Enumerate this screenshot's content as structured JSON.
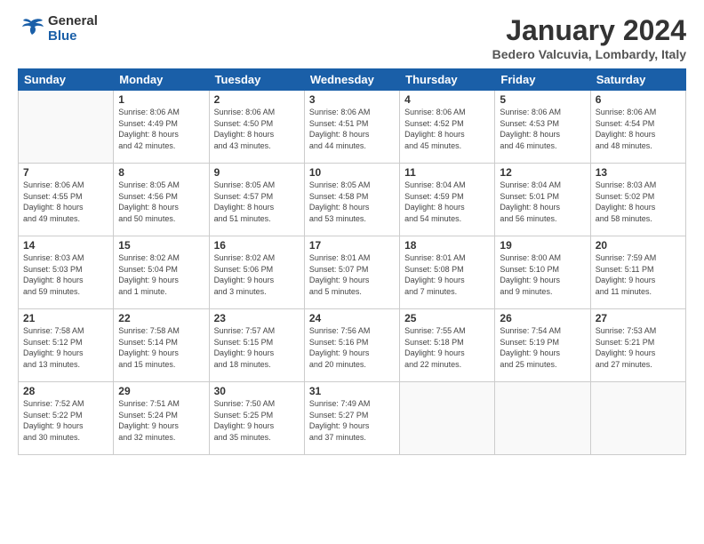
{
  "header": {
    "logo_line1": "General",
    "logo_line2": "Blue",
    "month_title": "January 2024",
    "subtitle": "Bedero Valcuvia, Lombardy, Italy"
  },
  "weekdays": [
    "Sunday",
    "Monday",
    "Tuesday",
    "Wednesday",
    "Thursday",
    "Friday",
    "Saturday"
  ],
  "weeks": [
    [
      {
        "day": "",
        "info": ""
      },
      {
        "day": "1",
        "info": "Sunrise: 8:06 AM\nSunset: 4:49 PM\nDaylight: 8 hours\nand 42 minutes."
      },
      {
        "day": "2",
        "info": "Sunrise: 8:06 AM\nSunset: 4:50 PM\nDaylight: 8 hours\nand 43 minutes."
      },
      {
        "day": "3",
        "info": "Sunrise: 8:06 AM\nSunset: 4:51 PM\nDaylight: 8 hours\nand 44 minutes."
      },
      {
        "day": "4",
        "info": "Sunrise: 8:06 AM\nSunset: 4:52 PM\nDaylight: 8 hours\nand 45 minutes."
      },
      {
        "day": "5",
        "info": "Sunrise: 8:06 AM\nSunset: 4:53 PM\nDaylight: 8 hours\nand 46 minutes."
      },
      {
        "day": "6",
        "info": "Sunrise: 8:06 AM\nSunset: 4:54 PM\nDaylight: 8 hours\nand 48 minutes."
      }
    ],
    [
      {
        "day": "7",
        "info": "Sunrise: 8:06 AM\nSunset: 4:55 PM\nDaylight: 8 hours\nand 49 minutes."
      },
      {
        "day": "8",
        "info": "Sunrise: 8:05 AM\nSunset: 4:56 PM\nDaylight: 8 hours\nand 50 minutes."
      },
      {
        "day": "9",
        "info": "Sunrise: 8:05 AM\nSunset: 4:57 PM\nDaylight: 8 hours\nand 51 minutes."
      },
      {
        "day": "10",
        "info": "Sunrise: 8:05 AM\nSunset: 4:58 PM\nDaylight: 8 hours\nand 53 minutes."
      },
      {
        "day": "11",
        "info": "Sunrise: 8:04 AM\nSunset: 4:59 PM\nDaylight: 8 hours\nand 54 minutes."
      },
      {
        "day": "12",
        "info": "Sunrise: 8:04 AM\nSunset: 5:01 PM\nDaylight: 8 hours\nand 56 minutes."
      },
      {
        "day": "13",
        "info": "Sunrise: 8:03 AM\nSunset: 5:02 PM\nDaylight: 8 hours\nand 58 minutes."
      }
    ],
    [
      {
        "day": "14",
        "info": "Sunrise: 8:03 AM\nSunset: 5:03 PM\nDaylight: 8 hours\nand 59 minutes."
      },
      {
        "day": "15",
        "info": "Sunrise: 8:02 AM\nSunset: 5:04 PM\nDaylight: 9 hours\nand 1 minute."
      },
      {
        "day": "16",
        "info": "Sunrise: 8:02 AM\nSunset: 5:06 PM\nDaylight: 9 hours\nand 3 minutes."
      },
      {
        "day": "17",
        "info": "Sunrise: 8:01 AM\nSunset: 5:07 PM\nDaylight: 9 hours\nand 5 minutes."
      },
      {
        "day": "18",
        "info": "Sunrise: 8:01 AM\nSunset: 5:08 PM\nDaylight: 9 hours\nand 7 minutes."
      },
      {
        "day": "19",
        "info": "Sunrise: 8:00 AM\nSunset: 5:10 PM\nDaylight: 9 hours\nand 9 minutes."
      },
      {
        "day": "20",
        "info": "Sunrise: 7:59 AM\nSunset: 5:11 PM\nDaylight: 9 hours\nand 11 minutes."
      }
    ],
    [
      {
        "day": "21",
        "info": "Sunrise: 7:58 AM\nSunset: 5:12 PM\nDaylight: 9 hours\nand 13 minutes."
      },
      {
        "day": "22",
        "info": "Sunrise: 7:58 AM\nSunset: 5:14 PM\nDaylight: 9 hours\nand 15 minutes."
      },
      {
        "day": "23",
        "info": "Sunrise: 7:57 AM\nSunset: 5:15 PM\nDaylight: 9 hours\nand 18 minutes."
      },
      {
        "day": "24",
        "info": "Sunrise: 7:56 AM\nSunset: 5:16 PM\nDaylight: 9 hours\nand 20 minutes."
      },
      {
        "day": "25",
        "info": "Sunrise: 7:55 AM\nSunset: 5:18 PM\nDaylight: 9 hours\nand 22 minutes."
      },
      {
        "day": "26",
        "info": "Sunrise: 7:54 AM\nSunset: 5:19 PM\nDaylight: 9 hours\nand 25 minutes."
      },
      {
        "day": "27",
        "info": "Sunrise: 7:53 AM\nSunset: 5:21 PM\nDaylight: 9 hours\nand 27 minutes."
      }
    ],
    [
      {
        "day": "28",
        "info": "Sunrise: 7:52 AM\nSunset: 5:22 PM\nDaylight: 9 hours\nand 30 minutes."
      },
      {
        "day": "29",
        "info": "Sunrise: 7:51 AM\nSunset: 5:24 PM\nDaylight: 9 hours\nand 32 minutes."
      },
      {
        "day": "30",
        "info": "Sunrise: 7:50 AM\nSunset: 5:25 PM\nDaylight: 9 hours\nand 35 minutes."
      },
      {
        "day": "31",
        "info": "Sunrise: 7:49 AM\nSunset: 5:27 PM\nDaylight: 9 hours\nand 37 minutes."
      },
      {
        "day": "",
        "info": ""
      },
      {
        "day": "",
        "info": ""
      },
      {
        "day": "",
        "info": ""
      }
    ]
  ]
}
